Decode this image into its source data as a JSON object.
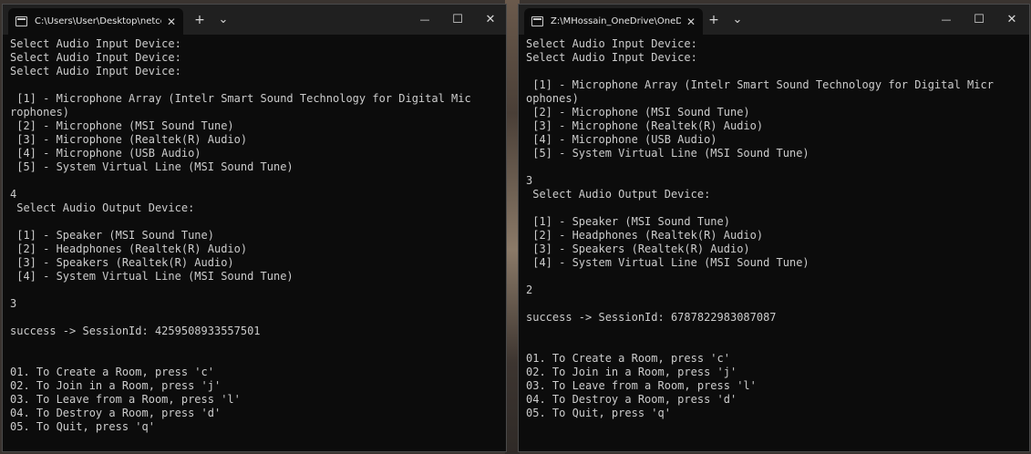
{
  "windows": [
    {
      "tab_title": "C:\\Users\\User\\Desktop\\netco",
      "lines": [
        "Select Audio Input Device:",
        "Select Audio Input Device:",
        "Select Audio Input Device:",
        "",
        " [1] - Microphone Array (Intelr Smart Sound Technology for Digital Mic",
        "rophones)",
        " [2] - Microphone (MSI Sound Tune)",
        " [3] - Microphone (Realtek(R) Audio)",
        " [4] - Microphone (USB Audio)",
        " [5] - System Virtual Line (MSI Sound Tune)",
        "",
        "4",
        " Select Audio Output Device:",
        "",
        " [1] - Speaker (MSI Sound Tune)",
        " [2] - Headphones (Realtek(R) Audio)",
        " [3] - Speakers (Realtek(R) Audio)",
        " [4] - System Virtual Line (MSI Sound Tune)",
        "",
        "3",
        "",
        "success -> SessionId: 4259508933557501",
        "",
        "",
        "01. To Create a Room, press 'c'",
        "02. To Join in a Room, press 'j'",
        "03. To Leave from a Room, press 'l'",
        "04. To Destroy a Room, press 'd'",
        "05. To Quit, press 'q'"
      ]
    },
    {
      "tab_title": "Z:\\MHossain_OneDrive\\OneD",
      "lines": [
        "Select Audio Input Device:",
        "Select Audio Input Device:",
        "",
        " [1] - Microphone Array (Intelr Smart Sound Technology for Digital Micr",
        "ophones)",
        " [2] - Microphone (MSI Sound Tune)",
        " [3] - Microphone (Realtek(R) Audio)",
        " [4] - Microphone (USB Audio)",
        " [5] - System Virtual Line (MSI Sound Tune)",
        "",
        "3",
        " Select Audio Output Device:",
        "",
        " [1] - Speaker (MSI Sound Tune)",
        " [2] - Headphones (Realtek(R) Audio)",
        " [3] - Speakers (Realtek(R) Audio)",
        " [4] - System Virtual Line (MSI Sound Tune)",
        "",
        "2",
        "",
        "success -> SessionId: 6787822983087087",
        "",
        "",
        "01. To Create a Room, press 'c'",
        "02. To Join in a Room, press 'j'",
        "03. To Leave from a Room, press 'l'",
        "04. To Destroy a Room, press 'd'",
        "05. To Quit, press 'q'"
      ]
    }
  ],
  "controls": {
    "close_tab": "✕",
    "new_tab": "+",
    "dropdown": "⌄",
    "minimize": "—",
    "maximize": "☐",
    "close": "✕"
  },
  "colors": {
    "terminal_bg": "#0c0c0c",
    "terminal_fg": "#cccccc",
    "titlebar_bg": "#202020"
  },
  "icons": [
    "terminal-icon",
    "close-icon",
    "plus-icon",
    "chevron-down-icon",
    "minimize-icon",
    "maximize-icon"
  ]
}
